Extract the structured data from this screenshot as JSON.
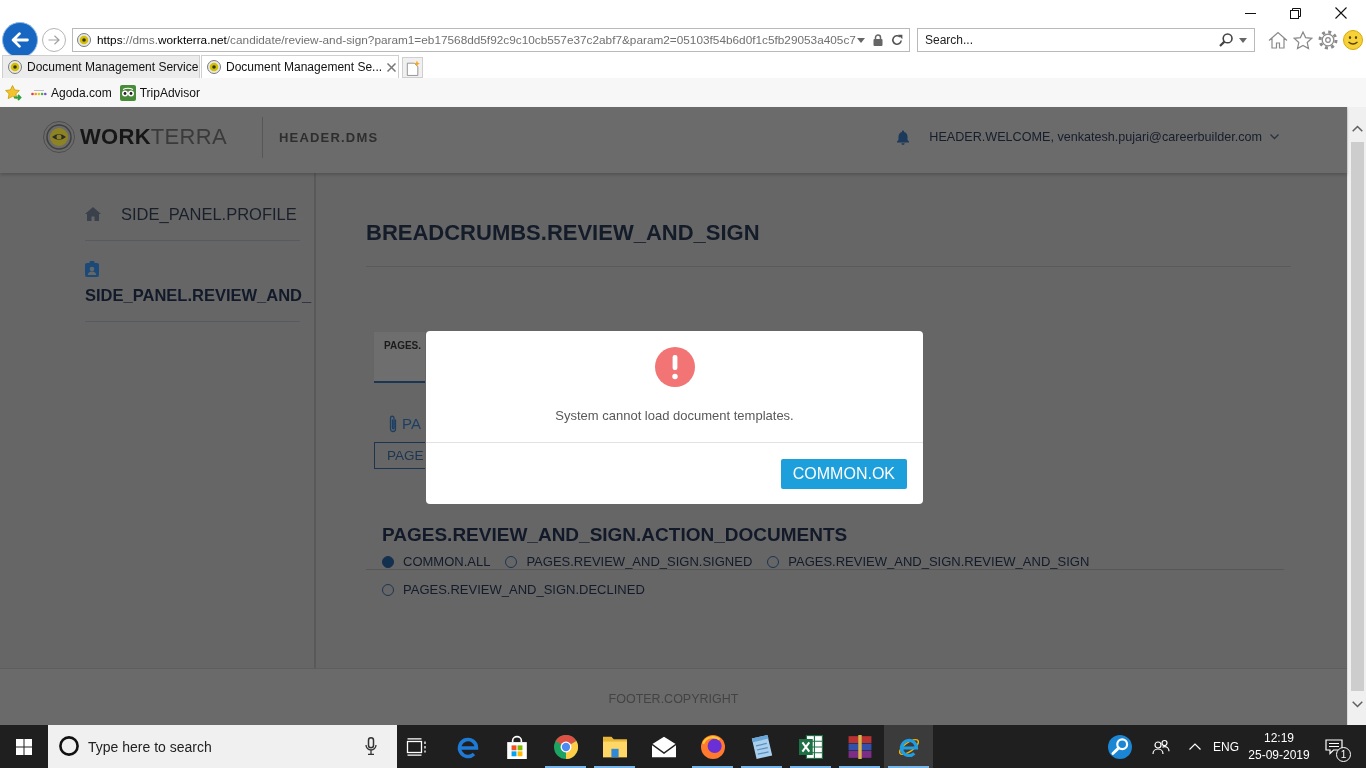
{
  "browser": {
    "address": "**https**://dms.**workterra.net**/candidate/review-and-sign?param1=eb17568dd5f92c9c10cb557e37c2abf7&param2=05103f54b6d0f1c5fb29053a405c7",
    "search": {
      "placeholder": "Search..."
    },
    "tabs": [
      {
        "title": "Document Management Service",
        "selected": false
      },
      {
        "title": "Document Management Se...",
        "selected": true
      }
    ],
    "favorites": [
      {
        "label": "Agoda.com",
        "kind": "agoda"
      },
      {
        "label": "TripAdvisor",
        "kind": "tripadvisor"
      }
    ]
  },
  "page": {
    "logo": "**WORK**TERRA",
    "section": "HEADER.DMS",
    "welcome": "HEADER.WELCOME, venkatesh.pujari@careerbuilder.com",
    "sidebar": [
      {
        "label": "SIDE_PANEL.PROFILE",
        "kind": "home",
        "selected": false
      },
      {
        "label": "SIDE_PANEL.REVIEW_AND_",
        "kind": "badge",
        "selected": true
      }
    ],
    "title": "BREADCRUMBS.REVIEW_AND_SIGN",
    "card": {
      "tab": "PAGES.",
      "attachment": "PA",
      "button": "PAGE"
    },
    "actions": {
      "title": "PAGES.REVIEW_AND_SIGN.ACTION_DOCUMENTS",
      "filters": [
        {
          "label": "COMMON.ALL",
          "selected": true
        },
        {
          "label": "PAGES.REVIEW_AND_SIGN.SIGNED",
          "selected": false
        },
        {
          "label": "PAGES.REVIEW_AND_SIGN.REVIEW_AND_SIGN",
          "selected": false
        },
        {
          "label": "PAGES.REVIEW_AND_SIGN.DECLINED",
          "selected": false
        }
      ]
    },
    "footer": "FOOTER.COPYRIGHT"
  },
  "dialog": {
    "message": "System cannot load document templates.",
    "button": "COMMON.OK"
  },
  "taskbar": {
    "search": {
      "placeholder": "Type here to search"
    },
    "apps": [
      {
        "kind": "edge",
        "running": false,
        "active": false
      },
      {
        "kind": "store",
        "running": false,
        "active": false
      },
      {
        "kind": "chrome",
        "running": true,
        "active": false
      },
      {
        "kind": "explorer",
        "running": true,
        "active": false
      },
      {
        "kind": "mail",
        "running": false,
        "active": false
      },
      {
        "kind": "firefox",
        "running": true,
        "active": false
      },
      {
        "kind": "notes",
        "running": true,
        "active": false
      },
      {
        "kind": "excel",
        "running": true,
        "active": false
      },
      {
        "kind": "archive",
        "running": true,
        "active": false
      },
      {
        "kind": "ie",
        "running": true,
        "active": true
      }
    ],
    "language": "ENG",
    "time": "12:19",
    "date": "25-09-2019",
    "notifications": "1"
  }
}
